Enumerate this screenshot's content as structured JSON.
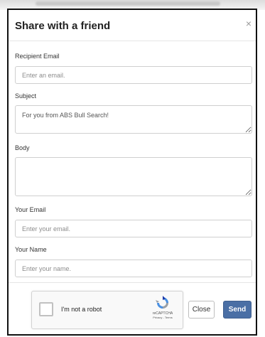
{
  "dialog": {
    "title": "Share with a friend",
    "close_icon": "×"
  },
  "form": {
    "recipient_email": {
      "label": "Recipient Email",
      "placeholder": "Enter an email."
    },
    "subject": {
      "label": "Subject",
      "value": "For you from ABS Bull Search!"
    },
    "body": {
      "label": "Body",
      "value": ""
    },
    "your_email": {
      "label": "Your Email",
      "placeholder": "Enter your email."
    },
    "your_name": {
      "label": "Your Name",
      "placeholder": "Enter your name."
    }
  },
  "captcha": {
    "label": "I'm not a robot",
    "brand": "reCAPTCHA",
    "links": "Privacy - Terms",
    "checked": false
  },
  "buttons": {
    "close_label": "Close",
    "send_label": "Send"
  },
  "colors": {
    "send_button": "#4a6fa5",
    "recaptcha_blue": "#4a90e2",
    "recaptcha_gray": "#9aa0a6"
  },
  "icons": {
    "close": "close-icon",
    "recaptcha": "recaptcha-logo-icon",
    "resize": "resize-grip-icon"
  }
}
